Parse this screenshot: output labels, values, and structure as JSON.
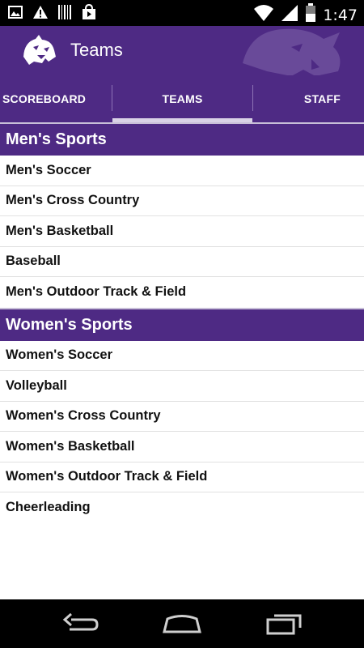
{
  "status_bar": {
    "time": "1:47",
    "icons": [
      "image-icon",
      "warning-icon",
      "barcode-icon",
      "shopping-bag-icon",
      "wifi-icon",
      "signal-icon",
      "battery-icon"
    ]
  },
  "action_bar": {
    "title": "Teams",
    "background": "#4e2a84"
  },
  "tabs": [
    {
      "label": "SCOREBOARD",
      "selected": false
    },
    {
      "label": "TEAMS",
      "selected": true
    },
    {
      "label": "STAFF",
      "selected": false
    }
  ],
  "sections": [
    {
      "header": "Men's Sports",
      "items": [
        "Men's Soccer",
        "Men's Cross Country",
        "Men's Basketball",
        "Baseball",
        "Men's Outdoor Track & Field"
      ]
    },
    {
      "header": "Women's Sports",
      "items": [
        "Women's Soccer",
        "Volleyball",
        "Women's Cross Country",
        "Women's Basketball",
        "Women's Outdoor Track & Field",
        "Cheerleading"
      ]
    }
  ],
  "nav_bar": {
    "icons": [
      "back-icon",
      "home-icon",
      "recents-icon"
    ]
  }
}
